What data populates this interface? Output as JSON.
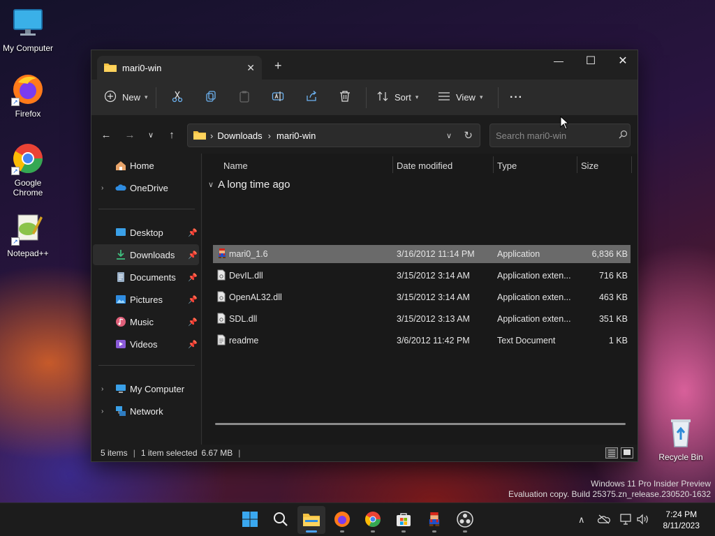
{
  "desktop": {
    "icons": [
      {
        "label": "My Computer"
      },
      {
        "label": "Firefox"
      },
      {
        "label": "Google Chrome"
      },
      {
        "label": "Notepad++"
      },
      {
        "label": "Recycle Bin"
      }
    ],
    "watermark_line1": "Windows 11 Pro Insider Preview",
    "watermark_line2": "Evaluation copy. Build 25375.zn_release.230520-1632"
  },
  "window": {
    "tab_title": "mari0-win",
    "tab_close": "✕",
    "new_tab": "+",
    "controls": {
      "minimize": "—",
      "maximize": "☐",
      "close": "✕"
    }
  },
  "toolbar": {
    "new_label": "New",
    "sort_label": "Sort",
    "view_label": "View",
    "more_label": "···"
  },
  "address": {
    "crumbs": [
      "Downloads",
      "mari0-win"
    ],
    "separator": "›",
    "search_placeholder": "Search mari0-win"
  },
  "sidebar": {
    "items": [
      {
        "label": "Home",
        "icon": "home-icon"
      },
      {
        "label": "OneDrive",
        "icon": "cloud-icon"
      },
      {
        "label": "Desktop",
        "icon": "desktop-icon",
        "pinned": true
      },
      {
        "label": "Downloads",
        "icon": "download-icon",
        "pinned": true,
        "selected": true
      },
      {
        "label": "Documents",
        "icon": "documents-icon",
        "pinned": true
      },
      {
        "label": "Pictures",
        "icon": "pictures-icon",
        "pinned": true
      },
      {
        "label": "Music",
        "icon": "music-icon",
        "pinned": true
      },
      {
        "label": "Videos",
        "icon": "videos-icon",
        "pinned": true
      },
      {
        "label": "My Computer",
        "icon": "computer-icon"
      },
      {
        "label": "Network",
        "icon": "network-icon"
      }
    ]
  },
  "filelist": {
    "columns": {
      "name": "Name",
      "date": "Date modified",
      "type": "Type",
      "size": "Size"
    },
    "group_label": "A long time ago",
    "rows": [
      {
        "name": "mari0_1.6",
        "date": "3/16/2012 11:14 PM",
        "type": "Application",
        "size": "6,836 KB",
        "selected": true
      },
      {
        "name": "DevIL.dll",
        "date": "3/15/2012 3:14 AM",
        "type": "Application exten...",
        "size": "716 KB"
      },
      {
        "name": "OpenAL32.dll",
        "date": "3/15/2012 3:14 AM",
        "type": "Application exten...",
        "size": "463 KB"
      },
      {
        "name": "SDL.dll",
        "date": "3/15/2012 3:13 AM",
        "type": "Application exten...",
        "size": "351 KB"
      },
      {
        "name": "readme",
        "date": "3/6/2012 11:42 PM",
        "type": "Text Document",
        "size": "1 KB"
      }
    ]
  },
  "status": {
    "items_count": "5 items",
    "selection": "1 item selected",
    "selection_size": "6.67 MB",
    "sep": "|"
  },
  "taskbar": {
    "time": "7:24 PM",
    "date": "8/11/2023"
  },
  "colors": {
    "accent": "#4aa3ff",
    "window_bg": "#1c1c1c",
    "selected_row": "#6a6a6a"
  }
}
